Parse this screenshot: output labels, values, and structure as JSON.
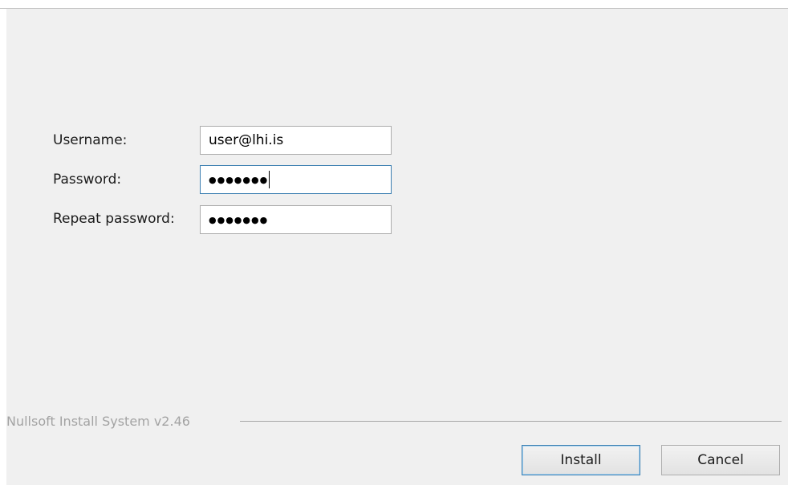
{
  "form": {
    "username_label": "Username:",
    "username_value": "user@lhi.is",
    "password_label": "Password:",
    "password_masked": "●●●●●●●",
    "repeat_password_label": "Repeat password:",
    "repeat_password_masked": "●●●●●●●"
  },
  "footer": {
    "branding": "Nullsoft Install System v2.46",
    "install_label": "Install",
    "cancel_label": "Cancel"
  },
  "colors": {
    "panel_background": "#f0f0f0",
    "focus_border": "#3c7fb1",
    "branding_text": "#a3a3a3"
  }
}
